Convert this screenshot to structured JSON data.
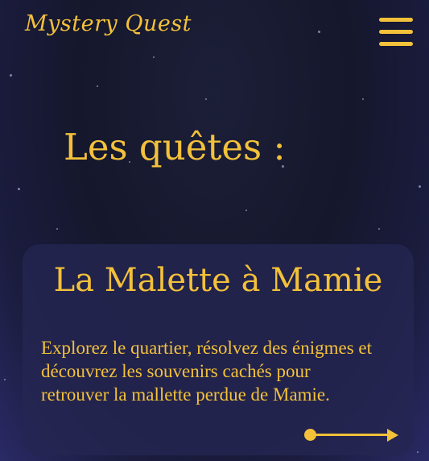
{
  "header": {
    "brand": "Mystery Quest",
    "menu_icon": "hamburger-menu-icon"
  },
  "section": {
    "title": "Les quêtes :"
  },
  "quests": [
    {
      "title": "La Malette à Mamie",
      "description": "Explorez le quartier, résolvez des énigmes et découvrez les souvenirs cachés pour retrouver la mallette perdue de Mamie.",
      "action_icon": "arrow-right-icon"
    }
  ],
  "colors": {
    "accent": "#f3c13a",
    "background": "#15172c",
    "card": "#242652"
  }
}
